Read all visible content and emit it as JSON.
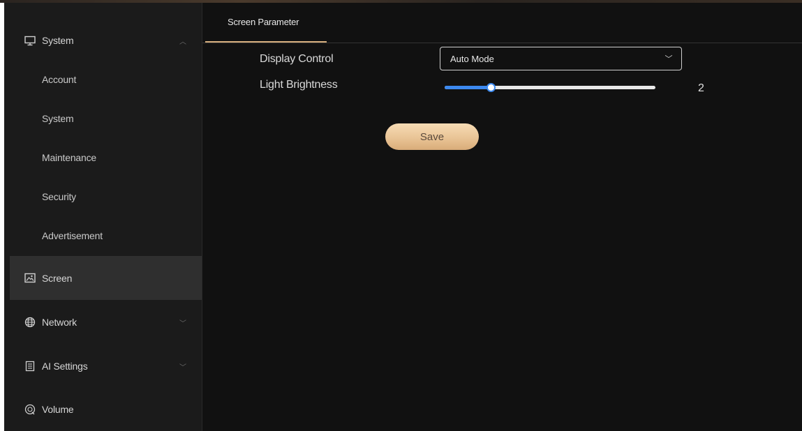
{
  "colors": {
    "background": "#111111",
    "sidebar": "#1b1b1b",
    "sidebar_active": "#2f2f2f",
    "accent_tab": "#d8b07f",
    "slider": "#3c89ef",
    "save_button": "#e9c496"
  },
  "sidebar": {
    "groups": {
      "system": {
        "label": "System",
        "icon": "monitor-icon",
        "expanded": true
      },
      "screen": {
        "label": "Screen",
        "icon": "image-icon",
        "active": true
      },
      "network": {
        "label": "Network",
        "icon": "globe-icon"
      },
      "ai_settings": {
        "label": "AI Settings",
        "icon": "document-icon"
      },
      "volume": {
        "label": "Volume",
        "icon": "volume-icon"
      }
    },
    "system_items": [
      "Account",
      "System",
      "Maintenance",
      "Security",
      "Advertisement"
    ]
  },
  "tabs": [
    {
      "label": "Screen Parameter",
      "active": true
    }
  ],
  "form": {
    "display_control": {
      "label": "Display Control",
      "value": "Auto Mode"
    },
    "light_brightness": {
      "label": "Light Brightness",
      "value": "2",
      "level_fraction": 0.2
    },
    "save_label": "Save"
  }
}
